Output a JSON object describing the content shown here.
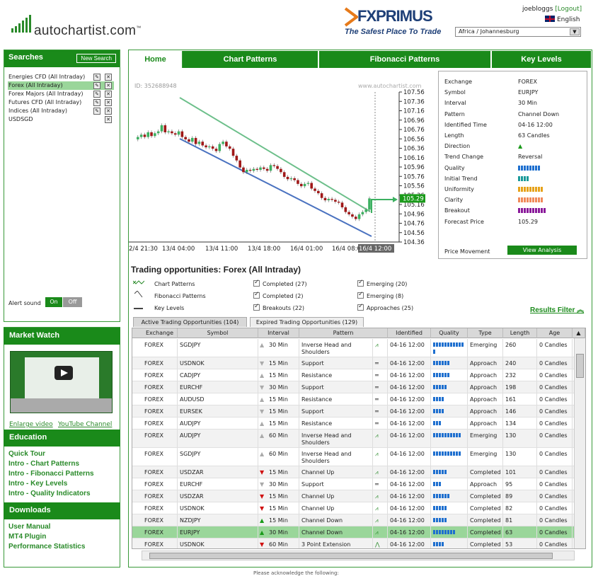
{
  "header": {
    "logo_text": "autochartist.com",
    "logo_tm": "™",
    "broker_name": "FXPRIMUS",
    "broker_tagline": "The Safest Place To Trade",
    "username": "joebloggs",
    "logout": "[Logout]",
    "language": "English",
    "timezone": "Africa / Johannesburg"
  },
  "searches": {
    "title": "Searches",
    "new_search": "New Search",
    "items": [
      {
        "label": "Energies CFD (All Intraday)",
        "selected": false,
        "edit": true
      },
      {
        "label": "Forex (All Intraday)",
        "selected": true,
        "edit": true
      },
      {
        "label": "Forex Majors (All Intraday)",
        "selected": false,
        "edit": true
      },
      {
        "label": "Futures CFD (All Intraday)",
        "selected": false,
        "edit": true
      },
      {
        "label": "Indices (All Intraday)",
        "selected": false,
        "edit": true
      },
      {
        "label": "USDSGD",
        "selected": false,
        "edit": false
      }
    ],
    "alert_label": "Alert sound",
    "alert_on": "On",
    "alert_off": "Off"
  },
  "market_watch": {
    "title": "Market Watch",
    "enlarge": "Enlarge video",
    "youtube": "YouTube Channel"
  },
  "education": {
    "title": "Education",
    "links": [
      "Quick Tour",
      "Intro - Chart Patterns",
      "Intro - Fibonacci Patterns",
      "Intro - Key Levels",
      "Intro - Quality Indicators"
    ]
  },
  "downloads": {
    "title": "Downloads",
    "links": [
      "User Manual",
      "MT4 Plugin",
      "Performance Statistics"
    ]
  },
  "tabs": [
    "Home",
    "Chart Patterns",
    "Fibonacci Patterns",
    "Key Levels"
  ],
  "chart": {
    "id": "ID: 352688948",
    "watermark": "www.autochartist.com",
    "price_label": "105.29",
    "price_ticks": [
      "107.56",
      "107.36",
      "107.16",
      "106.96",
      "106.76",
      "106.56",
      "106.36",
      "106.16",
      "105.96",
      "105.76",
      "105.56",
      "105.36",
      "105.16",
      "104.96",
      "104.76",
      "104.56",
      "104.36"
    ],
    "time_ticks": [
      "2/4 21:30",
      "13/4 04:00",
      "13/4 11:00",
      "13/4 18:00",
      "16/4 01:00",
      "16/4 08:00",
      "16/4 12:00"
    ]
  },
  "info": {
    "rows": [
      {
        "k": "Exchange",
        "v": "FOREX"
      },
      {
        "k": "Symbol",
        "v": "EURJPY"
      },
      {
        "k": "Interval",
        "v": "30 Min"
      },
      {
        "k": "Pattern",
        "v": "Channel Down"
      },
      {
        "k": "Identified Time",
        "v": "04-16 12:00"
      },
      {
        "k": "Length",
        "v": "63 Candles"
      },
      {
        "k": "Direction",
        "v": "▲"
      },
      {
        "k": "Trend Change",
        "v": "Reversal"
      },
      {
        "k": "Quality",
        "v": ""
      },
      {
        "k": "Initial Trend",
        "v": ""
      },
      {
        "k": "Uniformity",
        "v": ""
      },
      {
        "k": "Clarity",
        "v": ""
      },
      {
        "k": "Breakout",
        "v": ""
      },
      {
        "k": "Forecast Price",
        "v": "105.29"
      }
    ],
    "quality_bars": {
      "Quality": {
        "n": 8,
        "color": "#1e6fcf"
      },
      "Initial Trend": {
        "n": 4,
        "color": "#1a9a9a"
      },
      "Uniformity": {
        "n": 9,
        "color": "#e6a21a"
      },
      "Clarity": {
        "n": 9,
        "color": "#f08a5a"
      },
      "Breakout": {
        "n": 10,
        "color": "#8a1a9a"
      }
    },
    "price_movement": "Price Movement",
    "view_analysis": "View Analysis"
  },
  "opportunities": {
    "title": "Trading opportunities: Forex (All Intraday)",
    "filters": {
      "chart_patterns": "Chart Patterns",
      "fib_patterns": "Fibonacci Patterns",
      "key_levels": "Key Levels",
      "c1": "Completed (27)",
      "c2": "Completed (2)",
      "c3": "Breakouts (22)",
      "e1": "Emerging (20)",
      "e2": "Emerging (8)",
      "e3": "Approaches (25)"
    },
    "results_filter": "Results Filter",
    "active_tab": "Active Trading Opportunities (104)",
    "expired_tab": "Expired Trading Opportunities (129)"
  },
  "grid": {
    "headers": [
      "Exchange",
      "Symbol",
      "Interval",
      "Pattern",
      "Identified",
      "Quality",
      "Type",
      "Length",
      "Age"
    ],
    "rows": [
      {
        "ex": "FOREX",
        "sym": "SGDJPY",
        "dir": "up-grey",
        "int": "30 Min",
        "pat": "Inverse Head and Shoulders",
        "icon": "zig",
        "id": "04-16 12:00",
        "q": 12,
        "type": "Emerging",
        "len": "260",
        "age": "0 Candles",
        "tall": true
      },
      {
        "ex": "FOREX",
        "sym": "USDNOK",
        "dir": "down-grey",
        "int": "15 Min",
        "pat": "Support",
        "icon": "eq",
        "id": "04-16 12:00",
        "q": 6,
        "type": "Approach",
        "len": "240",
        "age": "0 Candles"
      },
      {
        "ex": "FOREX",
        "sym": "CADJPY",
        "dir": "up-grey",
        "int": "15 Min",
        "pat": "Resistance",
        "icon": "eq",
        "id": "04-16 12:00",
        "q": 6,
        "type": "Approach",
        "len": "232",
        "age": "0 Candles"
      },
      {
        "ex": "FOREX",
        "sym": "EURCHF",
        "dir": "down-grey",
        "int": "30 Min",
        "pat": "Support",
        "icon": "eq",
        "id": "04-16 12:00",
        "q": 5,
        "type": "Approach",
        "len": "198",
        "age": "0 Candles"
      },
      {
        "ex": "FOREX",
        "sym": "AUDUSD",
        "dir": "up-grey",
        "int": "15 Min",
        "pat": "Resistance",
        "icon": "eq",
        "id": "04-16 12:00",
        "q": 4,
        "type": "Approach",
        "len": "161",
        "age": "0 Candles"
      },
      {
        "ex": "FOREX",
        "sym": "EURSEK",
        "dir": "down-grey",
        "int": "15 Min",
        "pat": "Support",
        "icon": "eq",
        "id": "04-16 12:00",
        "q": 4,
        "type": "Approach",
        "len": "146",
        "age": "0 Candles"
      },
      {
        "ex": "FOREX",
        "sym": "AUDJPY",
        "dir": "up-grey",
        "int": "15 Min",
        "pat": "Resistance",
        "icon": "eq",
        "id": "04-16 12:00",
        "q": 3,
        "type": "Approach",
        "len": "134",
        "age": "0 Candles"
      },
      {
        "ex": "FOREX",
        "sym": "AUDJPY",
        "dir": "up-grey",
        "int": "60 Min",
        "pat": "Inverse Head and Shoulders",
        "icon": "zig",
        "id": "04-16 12:00",
        "q": 10,
        "type": "Emerging",
        "len": "130",
        "age": "0 Candles",
        "tall": true
      },
      {
        "ex": "FOREX",
        "sym": "SGDJPY",
        "dir": "up-grey",
        "int": "60 Min",
        "pat": "Inverse Head and Shoulders",
        "icon": "zig",
        "id": "04-16 12:00",
        "q": 10,
        "type": "Emerging",
        "len": "130",
        "age": "0 Candles",
        "tall": true
      },
      {
        "ex": "FOREX",
        "sym": "USDZAR",
        "dir": "down-red",
        "int": "15 Min",
        "pat": "Channel Up",
        "icon": "zig",
        "id": "04-16 12:00",
        "q": 5,
        "type": "Completed",
        "len": "101",
        "age": "0 Candles"
      },
      {
        "ex": "FOREX",
        "sym": "EURCHF",
        "dir": "down-grey",
        "int": "30 Min",
        "pat": "Support",
        "icon": "eq",
        "id": "04-16 12:00",
        "q": 3,
        "type": "Approach",
        "len": "95",
        "age": "0 Candles"
      },
      {
        "ex": "FOREX",
        "sym": "USDZAR",
        "dir": "down-red",
        "int": "15 Min",
        "pat": "Channel Up",
        "icon": "zig",
        "id": "04-16 12:00",
        "q": 6,
        "type": "Completed",
        "len": "89",
        "age": "0 Candles"
      },
      {
        "ex": "FOREX",
        "sym": "USDNOK",
        "dir": "down-red",
        "int": "15 Min",
        "pat": "Channel Up",
        "icon": "zig",
        "id": "04-16 12:00",
        "q": 5,
        "type": "Completed",
        "len": "82",
        "age": "0 Candles"
      },
      {
        "ex": "FOREX",
        "sym": "NZDJPY",
        "dir": "up-green",
        "int": "15 Min",
        "pat": "Channel Down",
        "icon": "zig",
        "id": "04-16 12:00",
        "q": 5,
        "type": "Completed",
        "len": "81",
        "age": "0 Candles"
      },
      {
        "ex": "FOREX",
        "sym": "EURJPY",
        "dir": "up-green",
        "int": "30 Min",
        "pat": "Channel Down",
        "icon": "zig",
        "id": "04-16 12:00",
        "q": 8,
        "type": "Completed",
        "len": "63",
        "age": "0 Candles",
        "selected": true
      },
      {
        "ex": "FOREX",
        "sym": "USDNOK",
        "dir": "down-red",
        "int": "60 Min",
        "pat": "3 Point Extension",
        "icon": "fib",
        "id": "04-16 12:00",
        "q": 4,
        "type": "Completed",
        "len": "53",
        "age": "0 Candles"
      }
    ]
  },
  "footer": {
    "acknowledge": "Please acknowledge the following:"
  }
}
